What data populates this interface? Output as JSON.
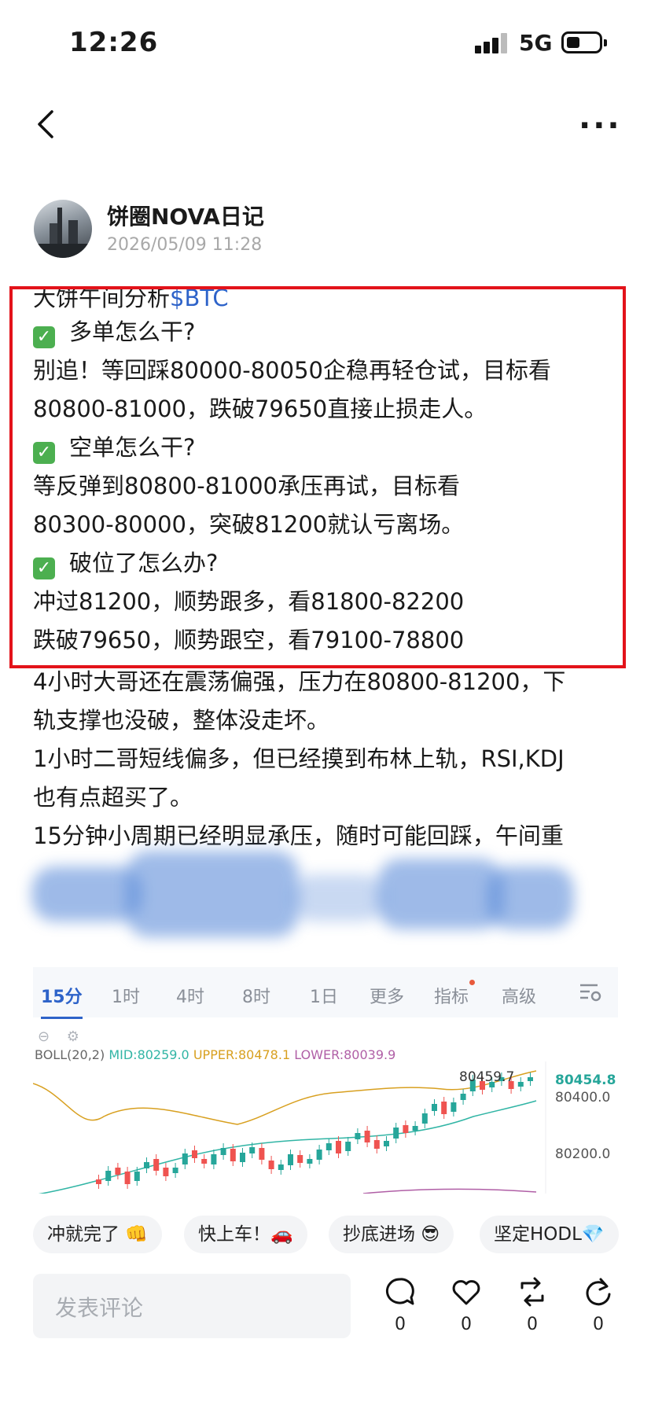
{
  "status_bar": {
    "time": "12:26",
    "network": "5G"
  },
  "nav": {
    "back_icon": "chevron-left-icon",
    "more_label": "···"
  },
  "author": {
    "name": "饼圈NOVA日记",
    "timestamp": "2026/05/09 11:28"
  },
  "post": {
    "title_prefix": "大饼午间分析",
    "tag": "$BTC",
    "lines": [
      "多单怎么干?",
      "别追！等回踩80000-80050企稳再轻仓试，目标看",
      "80800-81000，跌破79650直接止损走人。",
      "空单怎么干?",
      "等反弹到80800-81000承压再试，目标看",
      "80300-80000，突破81200就认亏离场。",
      "破位了怎么办?",
      "冲过81200，顺势跟多，看81800-82200",
      "跌破79650，顺势跟空，看79100-78800",
      "4小时大哥还在震荡偏强，压力在80800-81200，下",
      "轨支撑也没破，整体没走坏。",
      "1小时二哥短线偏多，但已经摸到布林上轨，RSI,KDJ",
      "也有点超买了。",
      "15分钟小周期已经明显承压，随时可能回踩，午间重"
    ],
    "check_mark": "✓",
    "highlight_color": "#e3131a"
  },
  "chart": {
    "tabs": [
      "15分",
      "1时",
      "4时",
      "8时",
      "1日",
      "更多",
      "指标",
      "高级"
    ],
    "active_tab": "15分",
    "settings_icon": "chart-settings-icon",
    "indicator": {
      "name": "BOLL(20,2)",
      "mid": "MID:80259.0",
      "upper": "UPPER:80478.1",
      "lower": "LOWER:80039.9"
    },
    "y_labels": [
      "80454.8",
      "80400.0",
      "80200.0"
    ],
    "high_marker": "80459.7",
    "colors": {
      "up": "#26a69a",
      "down": "#ef5350",
      "upper_band": "#d8a020",
      "mid_band": "#31b5a5",
      "lower_band": "#b05fa6",
      "accent": "#2e63c9"
    }
  },
  "reactions": [
    "冲就完了 👊",
    "快上车！🚗",
    "抄底进场 😎",
    "坚定HODL💎"
  ],
  "bottom_bar": {
    "comment_placeholder": "发表评论",
    "actions": [
      {
        "icon": "comment-icon",
        "count": "0"
      },
      {
        "icon": "heart-icon",
        "count": "0"
      },
      {
        "icon": "repost-icon",
        "count": "0"
      },
      {
        "icon": "share-icon",
        "count": "0"
      }
    ]
  }
}
